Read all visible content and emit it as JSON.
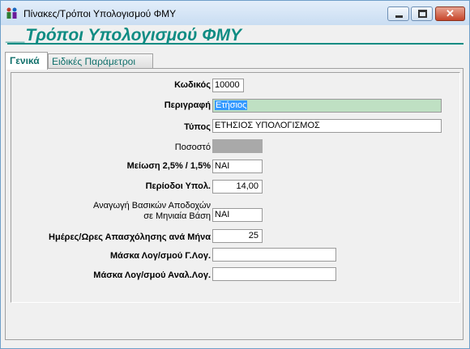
{
  "window": {
    "title": "Πίνακες/Τρόποι Υπολογισμού ΦΜΥ",
    "controls": [
      "minimize-icon",
      "maximize-icon",
      "close-icon"
    ]
  },
  "header": {
    "title": "__Τρόποι Υπολογισμού ΦΜΥ",
    "color": "#0f8c83"
  },
  "tabs": [
    {
      "label": "Γενικά",
      "active": true
    },
    {
      "label": "Ειδικές Παράμετροι",
      "active": false
    }
  ],
  "form": {
    "code": {
      "label": "Κωδικός",
      "value": "10000"
    },
    "description": {
      "label": "Περιγραφή",
      "value": "Ετήσιος"
    },
    "type": {
      "label": "Τύπος",
      "value": "ΕΤΗΣΙΟΣ ΥΠΟΛΟΓΙΣΜΟΣ"
    },
    "percentage": {
      "label": "Ποσοστό",
      "value": ""
    },
    "reduction": {
      "label": "Μείωση 2,5% / 1,5%",
      "value": "ΝΑΙ"
    },
    "periods": {
      "label": "Περίοδοι Υπολ.",
      "value": "14,00"
    },
    "monthly_base": {
      "label_line1": "Αναγωγή Βασικών Αποδοχών",
      "label_line2": "σε Μηνιαία Βάση",
      "value": "ΝΑΙ"
    },
    "days_hours": {
      "label": "Ημέρες/Ωρες Απασχόλησης ανά Μήνα",
      "value": "25"
    },
    "mask_gl": {
      "label": "Μάσκα Λογ/σμού Γ.Λογ.",
      "value": ""
    },
    "mask_al": {
      "label": "Μάσκα Λογ/σμού Αναλ.Λογ.",
      "value": ""
    }
  }
}
